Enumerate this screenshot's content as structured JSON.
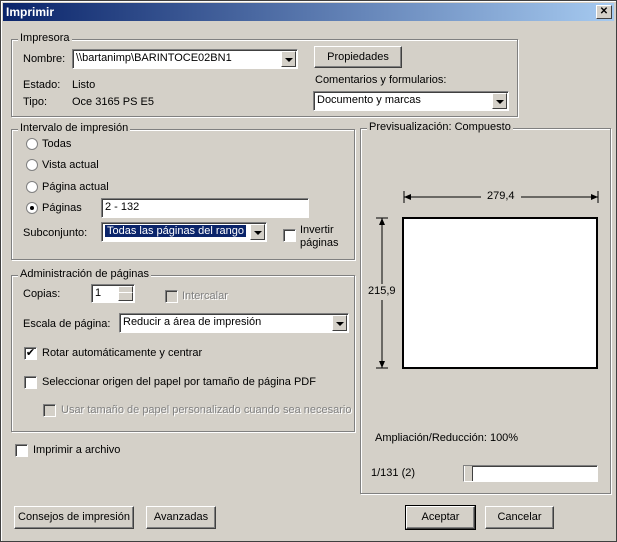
{
  "window": {
    "title": "Imprimir",
    "close": "✕"
  },
  "printer": {
    "group_label": "Impresora",
    "name_label": "Nombre:",
    "name_value": "\\\\bartanimp\\BARINTOCE02BN1",
    "properties_btn": "Propiedades",
    "status_label": "Estado:",
    "status_value": "Listo",
    "type_label": "Tipo:",
    "type_value": "Oce 3165 PS E5",
    "comments_label": "Comentarios y formularios:",
    "comments_value": "Documento y marcas"
  },
  "range": {
    "group_label": "Intervalo de impresión",
    "all": "Todas",
    "current_view": "Vista actual",
    "current_page": "Página actual",
    "pages": "Páginas",
    "pages_value": "2 - 132",
    "subset_label": "Subconjunto:",
    "subset_value": "Todas las páginas del rango",
    "reverse_line1": "Invertir",
    "reverse_line2": "páginas"
  },
  "handling": {
    "group_label": "Administración de páginas",
    "copies_label": "Copias:",
    "copies_value": "1",
    "collate": "Intercalar",
    "scale_label": "Escala de página:",
    "scale_value": "Reducir a área de impresión",
    "auto_rotate": "Rotar automáticamente y centrar",
    "paper_source": "Seleccionar origen del papel por tamaño de página PDF",
    "custom_paper": "Usar tamaño de papel personalizado cuando sea necesario"
  },
  "print_to_file": "Imprimir a archivo",
  "preview": {
    "group_label": "Previsualización: Compuesto",
    "width": "279,4",
    "height": "215,9",
    "zoom": "Ampliación/Reducción: 100%",
    "page_indicator": "1/131 (2)",
    "slider_fraction": 0
  },
  "buttons": {
    "tips": "Consejos de impresión",
    "advanced": "Avanzadas",
    "ok": "Aceptar",
    "cancel": "Cancelar"
  }
}
